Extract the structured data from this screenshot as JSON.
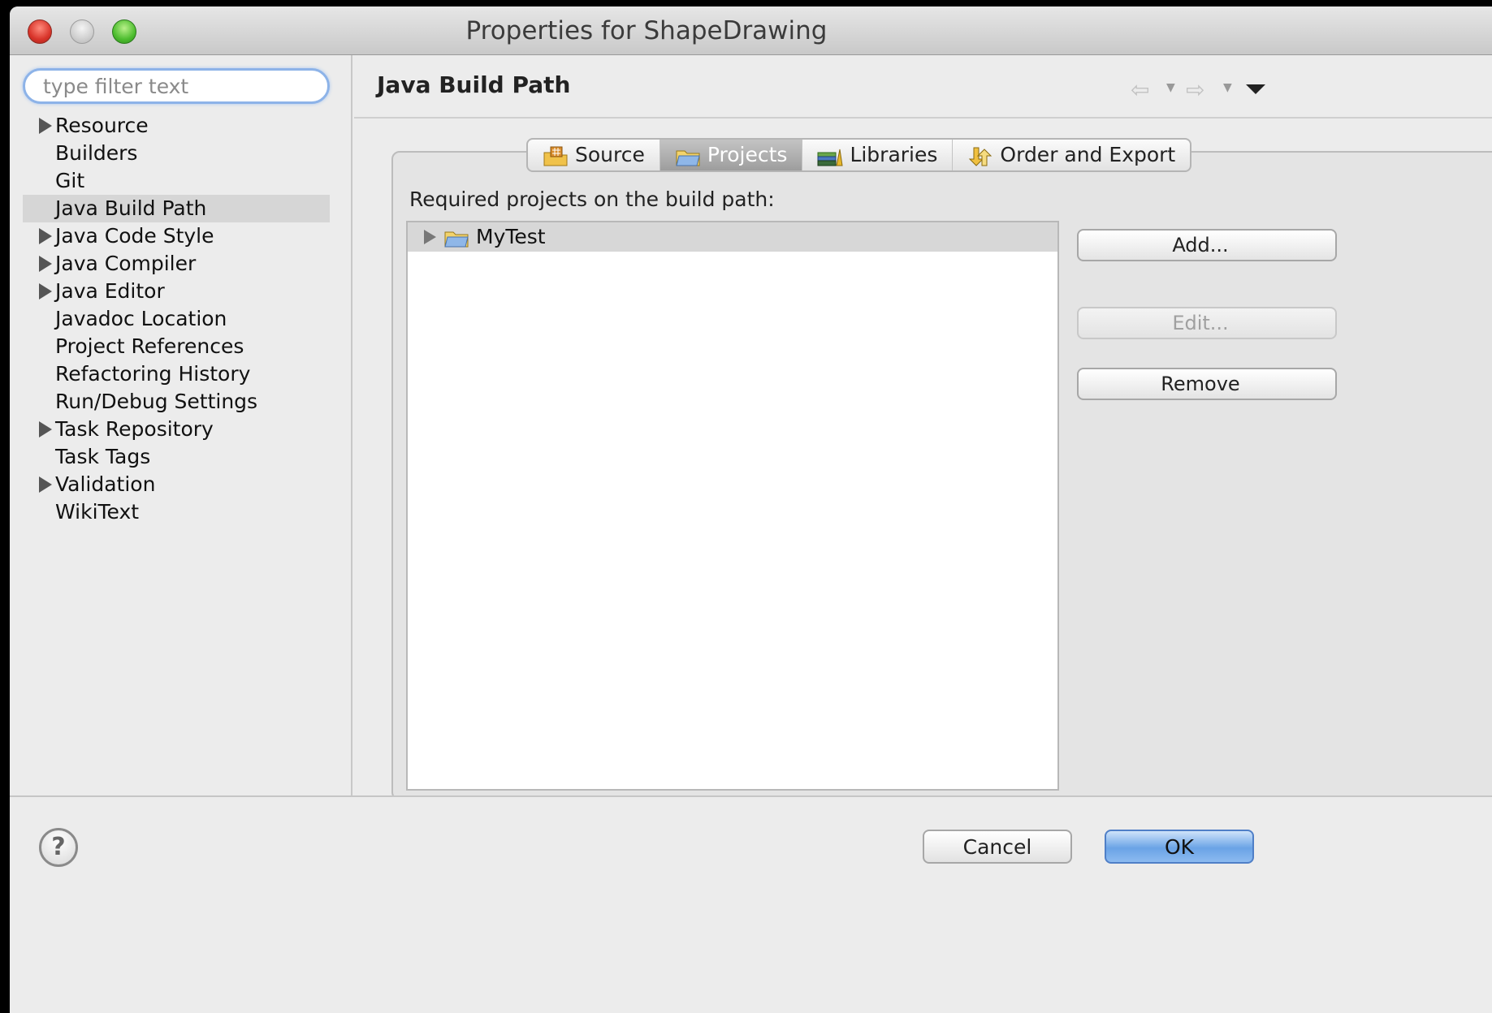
{
  "window": {
    "title": "Properties for ShapeDrawing"
  },
  "filter": {
    "placeholder": "type filter text"
  },
  "nav": {
    "items": [
      {
        "label": "Resource",
        "expandable": true
      },
      {
        "label": "Builders",
        "expandable": false
      },
      {
        "label": "Git",
        "expandable": false
      },
      {
        "label": "Java Build Path",
        "expandable": false,
        "selected": true
      },
      {
        "label": "Java Code Style",
        "expandable": true
      },
      {
        "label": "Java Compiler",
        "expandable": true
      },
      {
        "label": "Java Editor",
        "expandable": true
      },
      {
        "label": "Javadoc Location",
        "expandable": false
      },
      {
        "label": "Project References",
        "expandable": false
      },
      {
        "label": "Refactoring History",
        "expandable": false
      },
      {
        "label": "Run/Debug Settings",
        "expandable": false
      },
      {
        "label": "Task Repository",
        "expandable": true
      },
      {
        "label": "Task Tags",
        "expandable": false
      },
      {
        "label": "Validation",
        "expandable": true
      },
      {
        "label": "WikiText",
        "expandable": false
      }
    ]
  },
  "page": {
    "title": "Java Build Path",
    "tabs": [
      {
        "label": "Source",
        "icon": "source-folder-icon"
      },
      {
        "label": "Projects",
        "icon": "project-folder-icon",
        "active": true
      },
      {
        "label": "Libraries",
        "icon": "libraries-icon"
      },
      {
        "label": "Order and Export",
        "icon": "order-export-icon"
      }
    ],
    "required_label": "Required projects on the build path:",
    "projects": [
      {
        "name": "MyTest"
      }
    ],
    "buttons": {
      "add": "Add...",
      "edit": "Edit...",
      "remove": "Remove"
    }
  },
  "footer": {
    "cancel": "Cancel",
    "ok": "OK"
  },
  "colors": {
    "selection": "#d6d6d6",
    "ok_button": "#6aa3e6",
    "filter_focus": "#8db3e8"
  }
}
